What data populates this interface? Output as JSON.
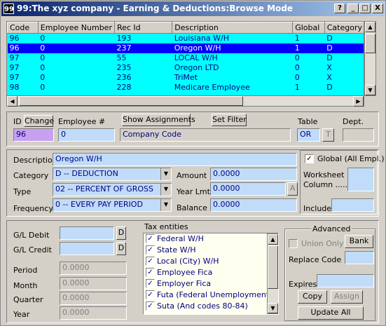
{
  "window": {
    "app_icon": "99",
    "title": "99:The xyz company - Earning & Deductions:Browse Mode"
  },
  "titlebar_buttons": {
    "help": "?",
    "minimize": "_",
    "maximize": "□",
    "close": "X"
  },
  "grid": {
    "columns": [
      "Code",
      "Employee Number",
      "Rec Id",
      "Description",
      "Global",
      "Category"
    ],
    "rows": [
      [
        "96",
        "0",
        "193",
        "Louisiana W/H",
        "1",
        "D"
      ],
      [
        "96",
        "0",
        "237",
        "Oregon W/H",
        "1",
        "D"
      ],
      [
        "97",
        "0",
        "55",
        "LOCAL W/H",
        "0",
        "D"
      ],
      [
        "97",
        "0",
        "235",
        "Oregon LTD",
        "0",
        "X"
      ],
      [
        "97",
        "0",
        "236",
        "TriMet",
        "0",
        "X"
      ],
      [
        "98",
        "0",
        "228",
        "Medicare Employee",
        "1",
        "D"
      ]
    ]
  },
  "header_form": {
    "id_label": "ID",
    "change_label": "Change",
    "employee_label": "Employee #",
    "show_assignments_label": "Show Assignments",
    "set_filter_label": "Set Filter",
    "table_label": "Table",
    "dept_label": "Dept.",
    "id_value": "96",
    "employee_value": "0",
    "company_code": "Company Code",
    "table_value": "OR",
    "table_button": "T",
    "dept_value": ""
  },
  "detail_form": {
    "description_label": "Description",
    "description_value": "Oregon W/H",
    "category_label": "Category",
    "category_value": "D -- DEDUCTION",
    "type_label": "Type",
    "type_value": "02 -- PERCENT OF GROSS",
    "frequency_label": "Frequency",
    "frequency_value": "0 -- EVERY PAY PERIOD",
    "amount_label": "Amount",
    "amount_value": "0.0000",
    "year_lmt_label": "Year Lmt.",
    "year_lmt_value": "0.0000",
    "year_lmt_button": "A",
    "balance_label": "Balance",
    "balance_value": "0.0000",
    "global_label": "Global (All Empl.)",
    "worksheet_label": "Worksheet\nColumn .....",
    "include_label": "Include"
  },
  "gl_form": {
    "gl_debit_label": "G/L Debit",
    "gl_credit_label": "G/L Credit",
    "d_button": "D",
    "period_label": "Period",
    "period_value": "0.0000",
    "month_label": "Month",
    "month_value": "0.0000",
    "quarter_label": "Quarter",
    "quarter_value": "0.0000",
    "year_label": "Year",
    "year_value": "0.0000"
  },
  "tax_entities": {
    "title": "Tax entities",
    "items": [
      "Federal W/H",
      "State W/H",
      "Local (City) W/H",
      "Employee Fica",
      "Employer Fica",
      "Futa (Federal Unemployment)",
      "Suta (And codes 80-84)"
    ]
  },
  "advanced": {
    "title": "Advanced",
    "union_only_label": "Union Only",
    "bank_label": "Bank",
    "replace_code_label": "Replace Code",
    "expires_label": "Expires",
    "copy_label": "Copy",
    "assign_label": "Assign",
    "update_all_label": "Update All"
  },
  "icons": {
    "check": "✓",
    "dropdown": "▼",
    "scroll_up": "▲",
    "scroll_down": "▼",
    "scroll_left": "◀",
    "scroll_right": "▶"
  },
  "colors": {
    "grid_bg": "#00ffff",
    "selected_row": "#0000ff",
    "field_bg": "#c0dcf8",
    "id_field_bg": "#c8a0f0",
    "tax_list_bg": "#fffff0",
    "title_gradient_start": "#0a246a"
  }
}
